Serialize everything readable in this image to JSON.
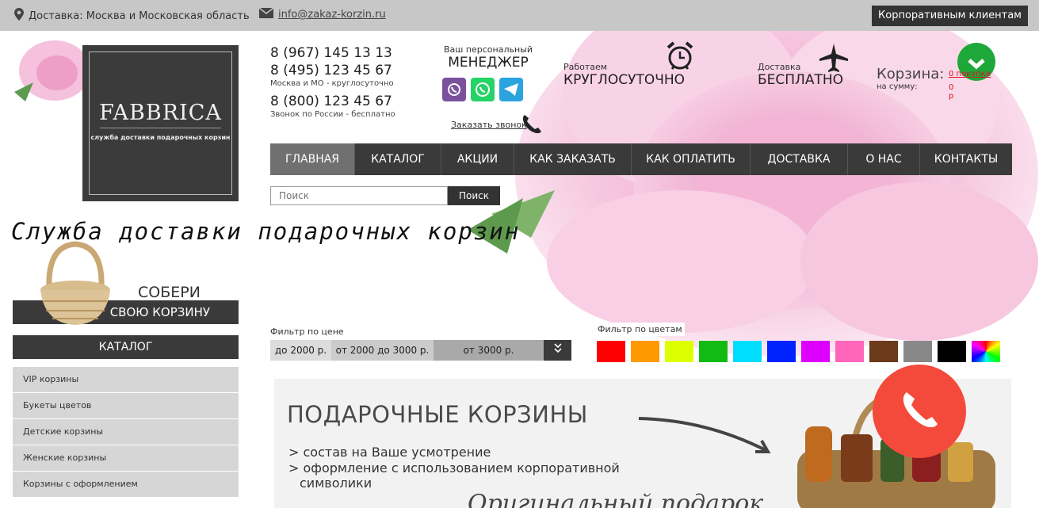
{
  "topbar": {
    "delivery": "Доставка: Москва и Московская область",
    "email": "info@zakaz-korzin.ru",
    "corporate": "Корпоративным клиентам"
  },
  "logo": {
    "name": "FABBRICA",
    "tagline": "служба доставки подарочных корзин"
  },
  "phones": {
    "moscow1": "8 (967) 145 13 13",
    "moscow2": "8 (495) 123 45 67",
    "moscow_note": "Москва и МО - круглосуточно",
    "russia": "8 (800) 123 45 67",
    "russia_note": "Звонок по России - бесплатно"
  },
  "manager": {
    "small": "Ваш персональный",
    "big": "МЕНЕДЖЕР",
    "callback": "Заказать звонок"
  },
  "features": {
    "hours_small": "Работаем",
    "hours_big": "КРУГЛОСУТОЧНО",
    "delivery_small": "Доставка",
    "delivery_big": "БЕСПЛАТНО"
  },
  "cart": {
    "title": "Корзина:",
    "count": "0 покупки",
    "sum_label": "на сумму:",
    "sum": "0 р"
  },
  "nav": [
    "ГЛАВНАЯ",
    "КАТАЛОГ",
    "АКЦИИ",
    "КАК ЗАКАЗАТЬ",
    "КАК ОПЛАТИТЬ",
    "ДОСТАВКА",
    "О НАС",
    "КОНТАКТЫ"
  ],
  "search": {
    "placeholder": "Поиск",
    "button": "Поиск"
  },
  "tagline": "Служба доставки подарочных корзин",
  "collect": {
    "top": "СОБЕРИ",
    "bottom": "СВОЮ КОРЗИНУ"
  },
  "catalog": {
    "title": "КАТАЛОГ",
    "items": [
      "VIP корзины",
      "Букеты цветов",
      "Детские корзины",
      "Женские корзины",
      "Корзины с оформлением"
    ]
  },
  "filters": {
    "price_label": "Фильтр по цене",
    "price": [
      "до 2000 р.",
      "от 2000 до 3000 р.",
      "от 3000 р."
    ],
    "color_label": "Фильтр по цветам",
    "colors": [
      "#ff0000",
      "#ff9900",
      "#ddff00",
      "#11bb11",
      "#00ddff",
      "#0022ff",
      "#dd00ff",
      "#ff66bb",
      "#6b3a1a",
      "#888888",
      "#000000",
      "rainbow"
    ]
  },
  "banner": {
    "title": "ПОДАРОЧНЫЕ КОРЗИНЫ",
    "bullets": [
      "> состав на Ваше усмотрение",
      "> оформление с использованием корпоративной",
      "символики"
    ],
    "script": "Оригинальный подарок"
  }
}
